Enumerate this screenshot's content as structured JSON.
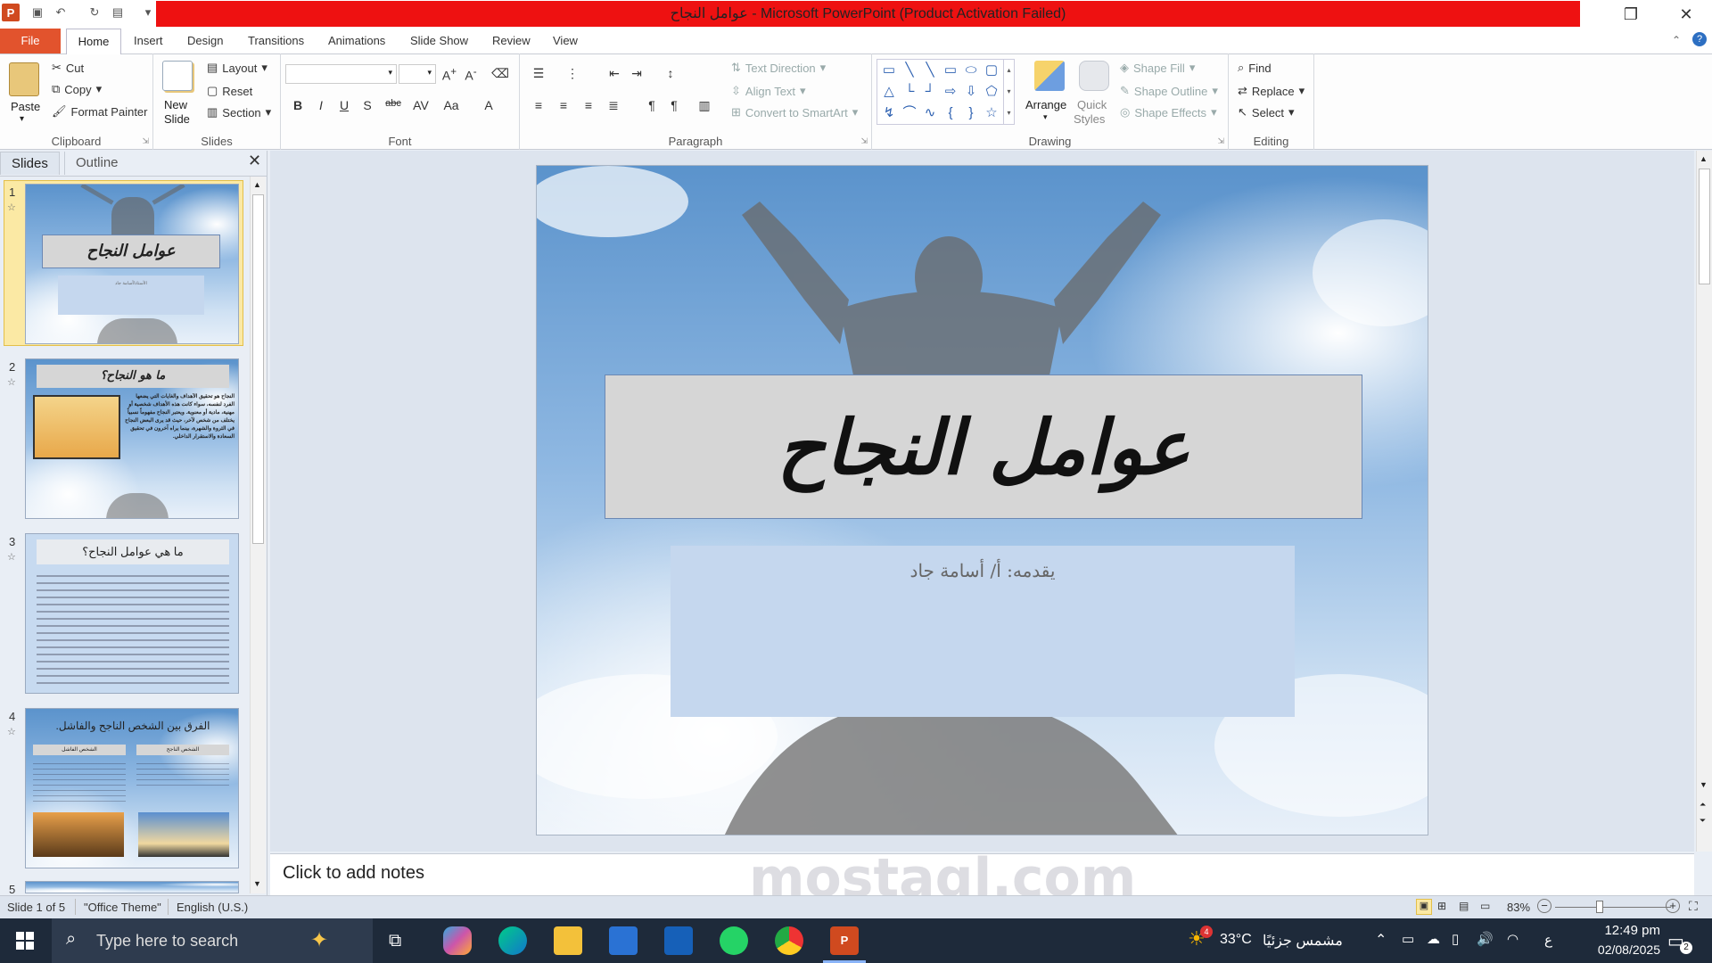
{
  "window": {
    "title": "عوامل النجاح  -  Microsoft PowerPoint (Product Activation Failed)"
  },
  "tabs": {
    "file": "File",
    "home": "Home",
    "insert": "Insert",
    "design": "Design",
    "transitions": "Transitions",
    "animations": "Animations",
    "slideshow": "Slide Show",
    "review": "Review",
    "view": "View"
  },
  "clipboard": {
    "paste": "Paste",
    "cut": "Cut",
    "copy": "Copy",
    "format_painter": "Format Painter",
    "label": "Clipboard"
  },
  "slides_group": {
    "new_slide": "New",
    "new_slide2": "Slide",
    "layout": "Layout",
    "reset": "Reset",
    "section": "Section",
    "label": "Slides"
  },
  "font_group": {
    "label": "Font",
    "bold": "B",
    "italic": "I",
    "underline": "U",
    "shadow": "S",
    "strike": "abc"
  },
  "paragraph": {
    "text_direction": "Text Direction",
    "align_text": "Align Text",
    "convert_smartart": "Convert to SmartArt",
    "label": "Paragraph"
  },
  "drawing": {
    "arrange": "Arrange",
    "quick": "Quick",
    "styles": "Styles",
    "shape_fill": "Shape Fill",
    "shape_outline": "Shape Outline",
    "shape_effects": "Shape Effects",
    "label": "Drawing"
  },
  "editing": {
    "find": "Find",
    "replace": "Replace",
    "select": "Select",
    "label": "Editing"
  },
  "pane": {
    "slides_tab": "Slides",
    "outline_tab": "Outline"
  },
  "thumbnails": [
    {
      "num": "1",
      "title": "عوامل النجاح",
      "subtitle": "الأستاذ/أسامة جاد"
    },
    {
      "num": "2",
      "title": "ما هو النجاح؟",
      "body": "النجاح هو تحقيق الأهداف والغايات التي يضعها الفرد لنفسه، سواء كانت هذه الأهداف شخصية أو مهنية، مادية أو معنوية. ويعتبر النجاح مفهوماً نسبياً يختلف من شخص لآخر، حيث قد يرى البعض النجاح في الثروة والشهرة، بينما يراه آخرون في تحقيق السعادة والاستقرار الداخلي."
    },
    {
      "num": "3",
      "title": "ما هي عوامل النجاح؟"
    },
    {
      "num": "4",
      "title": "الفرق بين الشخص الناجح والفاشل.",
      "left_head": "الشخص الفاشل",
      "right_head": "الشخص الناجح"
    },
    {
      "num": "5"
    }
  ],
  "slide": {
    "title": "عوامل النجاح",
    "subtitle": "يقدمه: أ/ أسامة جاد"
  },
  "notes": {
    "placeholder": "Click to add notes"
  },
  "status": {
    "slide": "Slide 1 of 5",
    "theme": "\"Office Theme\"",
    "language": "English (U.S.)",
    "zoom": "83%"
  },
  "taskbar": {
    "search_placeholder": "Type here to search",
    "temp": "33°C",
    "weather": "مشمس جزئيًا",
    "time": "12:49 pm",
    "date": "02/08/2025",
    "lang": "ع",
    "notif": "2",
    "weather_badge": "4"
  },
  "watermark": "mostaql.com"
}
